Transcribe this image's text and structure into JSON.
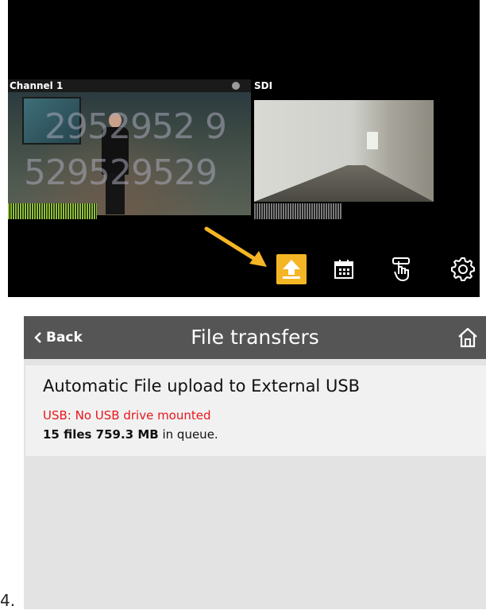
{
  "device_screen": {
    "channels": [
      {
        "label": "Channel 1",
        "watermark_top": "2952952 9",
        "watermark_bottom": "529529529"
      },
      {
        "label": "SDI"
      }
    ],
    "toolbar_icons": [
      "upload-icon",
      "calendar-icon",
      "touch-icon",
      "gear-icon"
    ],
    "colors": {
      "upload_active": "#f5b625",
      "arrow": "#f5b625"
    }
  },
  "file_transfers": {
    "header": {
      "back_label": "Back",
      "title": "File transfers",
      "home_icon": "home-icon"
    },
    "upload_item": {
      "title": "Automatic File upload to External USB",
      "status": "USB: No USB drive mounted",
      "queue_count": "15 files 759.3 MB",
      "queue_suffix": " in queue."
    },
    "colors": {
      "header": "#555555",
      "status_error": "#e8161b",
      "panel_bg": "#e3e3e3"
    }
  },
  "step_number": "4."
}
